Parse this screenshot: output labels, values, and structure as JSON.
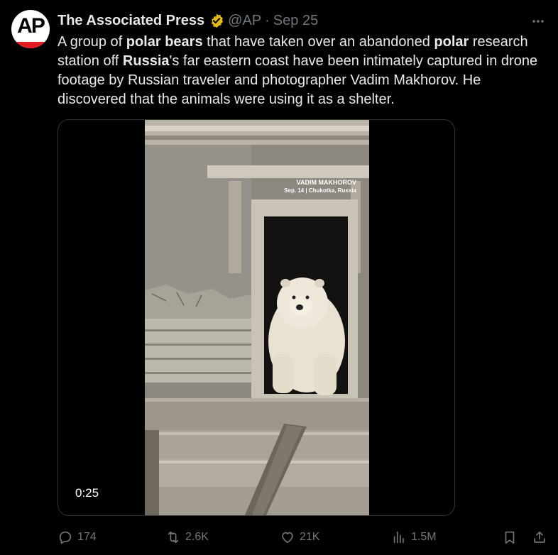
{
  "tweet": {
    "author_name": "The Associated Press",
    "handle": "@AP",
    "separator": "·",
    "date": "Sep 25",
    "avatar_text": "AP",
    "text_parts": [
      {
        "t": "A group of ",
        "b": false
      },
      {
        "t": "polar bears",
        "b": true
      },
      {
        "t": " that have taken over an abandoned ",
        "b": false
      },
      {
        "t": "polar",
        "b": true
      },
      {
        "t": " research station off ",
        "b": false
      },
      {
        "t": "Russia",
        "b": true
      },
      {
        "t": "'s far eastern coast have been intimately captured in drone footage by Russian traveler and photographer Vadim Makhorov. He discovered that the animals were using it as a shelter.",
        "b": false
      }
    ]
  },
  "media": {
    "type": "video",
    "duration": "0:25",
    "watermark_line1": "VADIM MAKHOROV",
    "watermark_line2": "Sep. 14 | Chukotka, Russia"
  },
  "actions": {
    "replies": "174",
    "reposts": "2.6K",
    "likes": "21K",
    "views": "1.5M"
  },
  "colors": {
    "background": "#000000",
    "text": "#e7e9ea",
    "muted": "#71767b",
    "verified_badge": "#e2b719",
    "ap_red": "#e31b23"
  }
}
